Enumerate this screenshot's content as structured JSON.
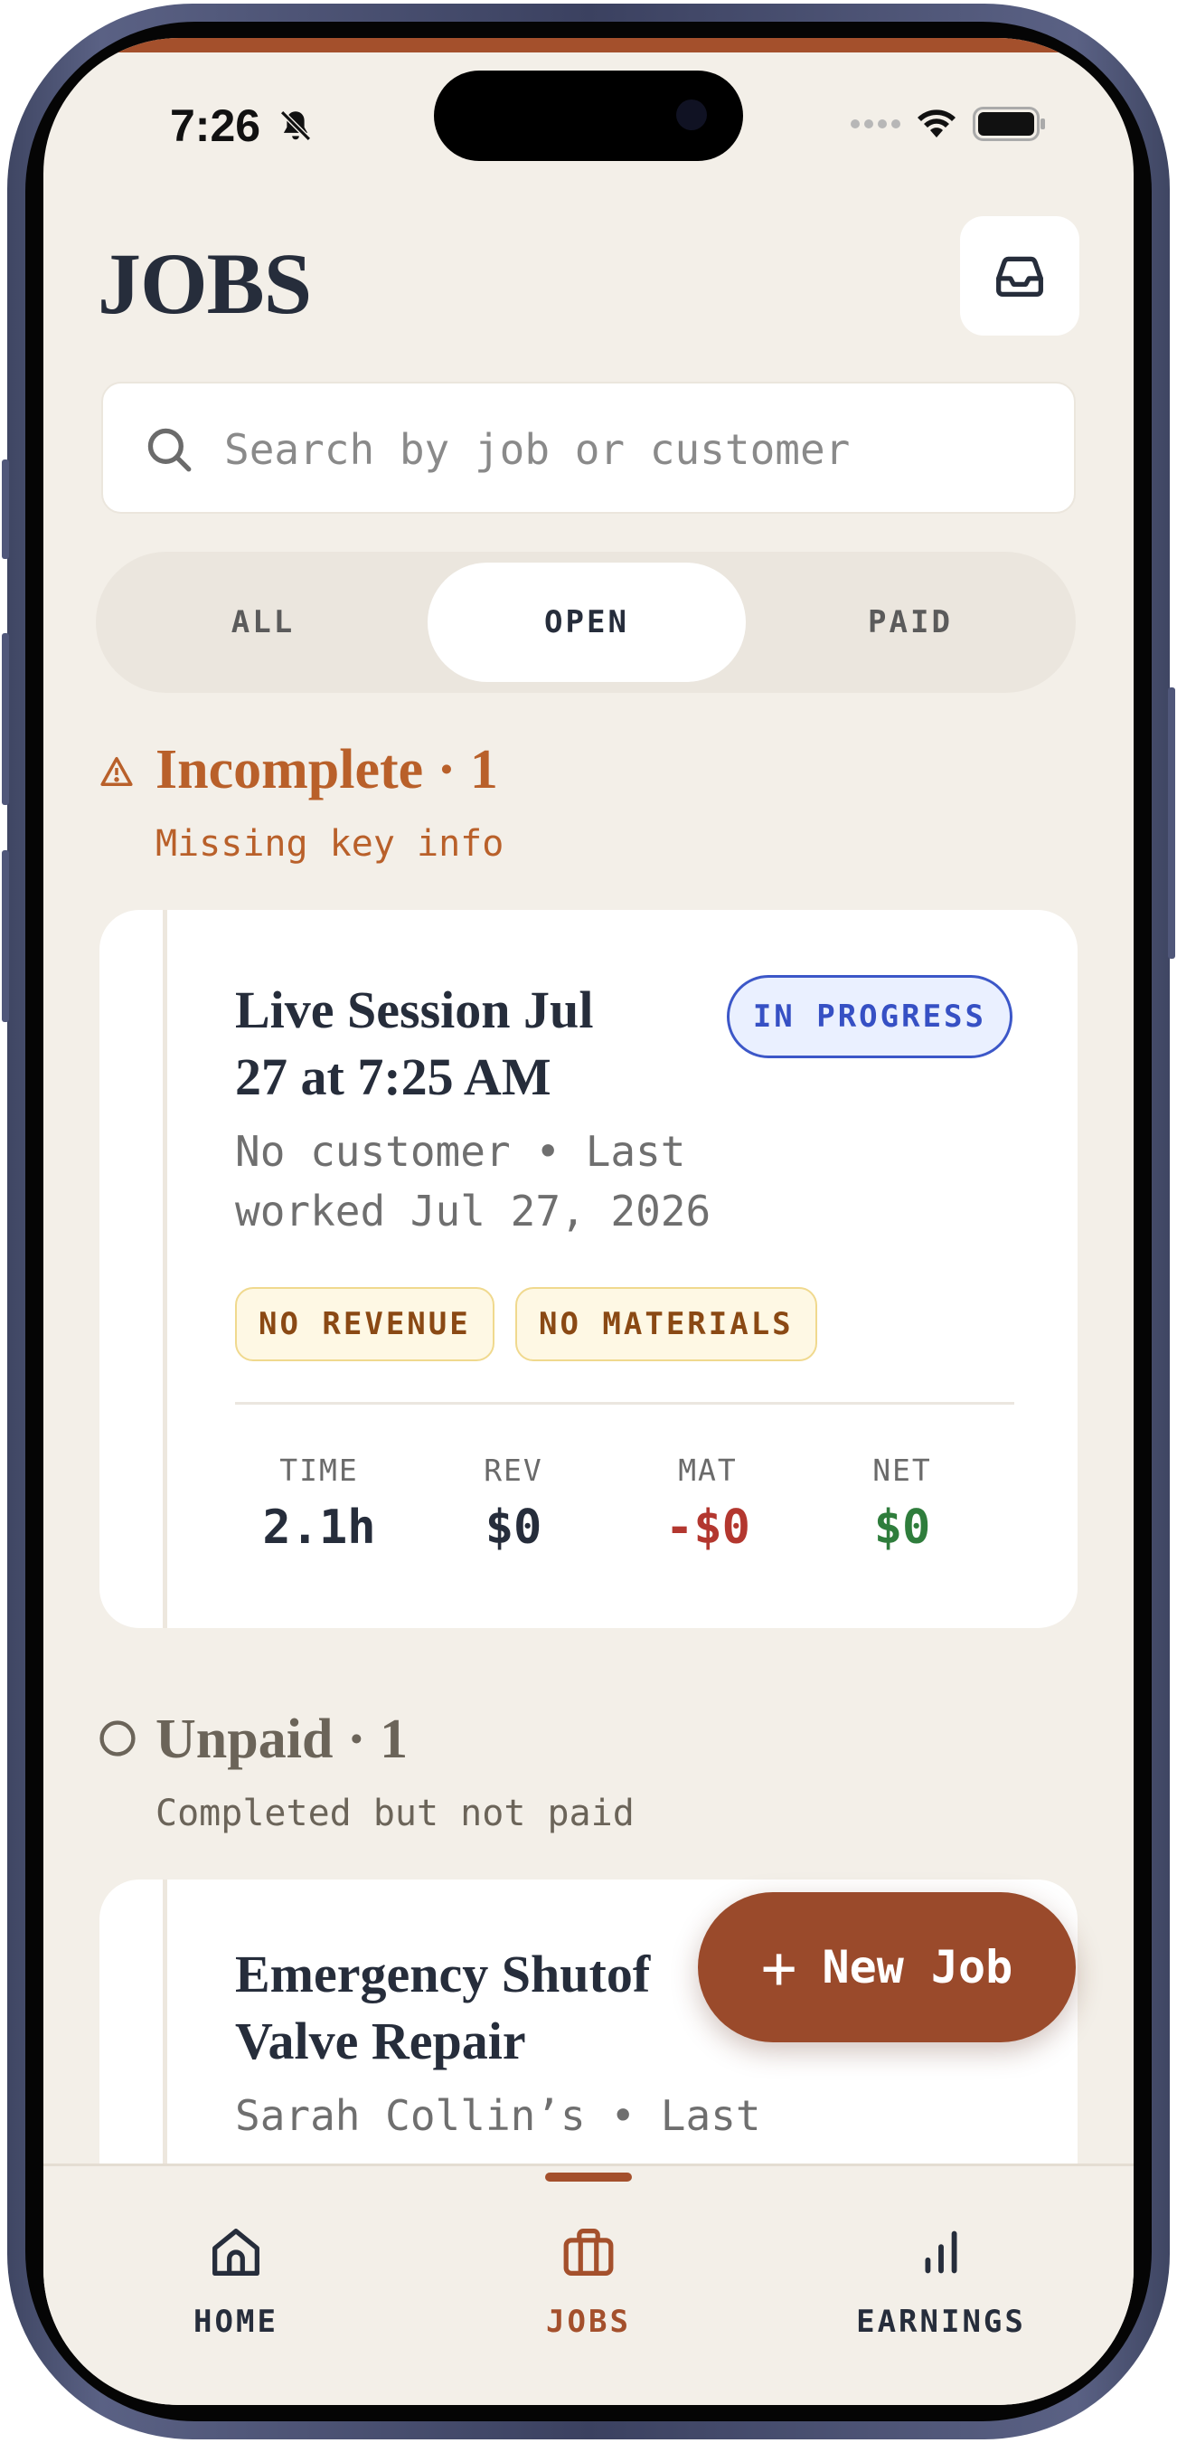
{
  "status_bar": {
    "time": "7:26"
  },
  "header": {
    "title": "JOBS",
    "inbox_icon": "inbox-icon"
  },
  "search": {
    "placeholder": "Search by job or customer"
  },
  "filter_tabs": [
    {
      "label": "ALL",
      "active": false
    },
    {
      "label": "OPEN",
      "active": true
    },
    {
      "label": "PAID",
      "active": false
    }
  ],
  "sections": {
    "incomplete": {
      "title": "Incomplete · 1",
      "subtitle": "Missing key info",
      "color": "#b9602a"
    },
    "unpaid": {
      "title": "Unpaid · 1",
      "subtitle": "Completed but not paid",
      "color": "#6b6459"
    }
  },
  "jobs": [
    {
      "title_line1": "Live Session Jul",
      "title_line2": "27 at 7:25 AM",
      "meta_line1": "No customer • Last",
      "meta_line2": "worked Jul 27, 2026",
      "status": "IN PROGRESS",
      "chips": [
        "NO REVENUE",
        "NO MATERIALS"
      ],
      "stats": [
        {
          "label": "TIME",
          "value": "2.1h",
          "color": "#262d3b"
        },
        {
          "label": "REV",
          "value": "$0",
          "color": "#262d3b"
        },
        {
          "label": "MAT",
          "value": "-$0",
          "color": "#b3372f"
        },
        {
          "label": "NET",
          "value": "$0",
          "color": "#2f7d3c"
        }
      ]
    },
    {
      "title_line1": "Emergency Shutof",
      "title_line2": "Valve Repair",
      "meta_line1": "Sarah Collin’s • Last"
    }
  ],
  "fab": {
    "label": "New Job",
    "icon": "plus-icon"
  },
  "bottom_nav": [
    {
      "label": "HOME",
      "icon": "home-icon",
      "active": false
    },
    {
      "label": "JOBS",
      "icon": "briefcase-icon",
      "active": true
    },
    {
      "label": "EARNINGS",
      "icon": "bar-chart-icon",
      "active": false
    }
  ],
  "colors": {
    "accent": "#a4502c",
    "background": "#f3efe8",
    "ink": "#262d3b"
  }
}
